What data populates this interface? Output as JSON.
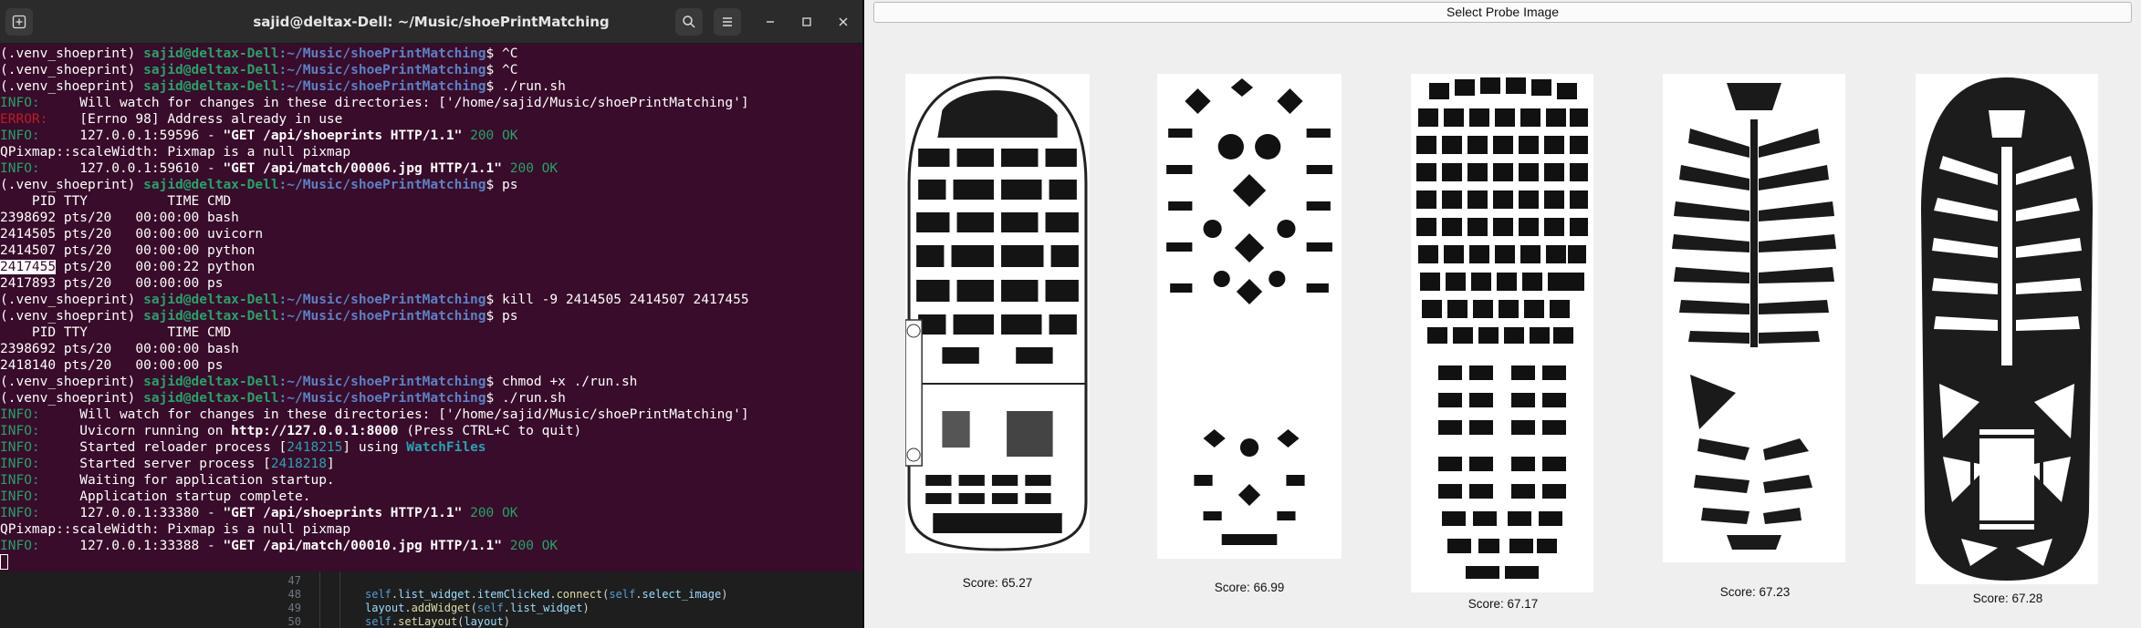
{
  "terminal": {
    "title": "sajid@deltax-Dell: ~/Music/shoePrintMatching",
    "new_tab_icon": "new-tab-icon",
    "search_icon": "search-icon",
    "menu_icon": "hamburger-menu-icon",
    "prompt": {
      "env": "(.venv_shoeprint) ",
      "user": "sajid@deltax-Dell",
      "path": ":~/Music/shoePrintMatching",
      "symbol": "$ "
    },
    "lines": [
      {
        "t": "cmd",
        "cmd": "^C"
      },
      {
        "t": "cmd",
        "cmd": "^C"
      },
      {
        "t": "cmd",
        "cmd": "./run.sh"
      },
      {
        "t": "info",
        "text": "     Will watch for changes in these directories: ['/home/sajid/Music/shoePrintMatching']"
      },
      {
        "t": "error",
        "text": "    [Errno 98] Address already in use"
      },
      {
        "t": "access",
        "ip": "     127.0.0.1:59596 - ",
        "req": "\"GET /api/shoeprints HTTP/1.1\"",
        "status": " 200 OK"
      },
      {
        "t": "plain",
        "text": "QPixmap::scaleWidth: Pixmap is a null pixmap"
      },
      {
        "t": "access",
        "ip": "     127.0.0.1:59610 - ",
        "req": "\"GET /api/match/00006.jpg HTTP/1.1\"",
        "status": " 200 OK"
      },
      {
        "t": "cmd",
        "cmd": "ps"
      },
      {
        "t": "plain",
        "text": "    PID TTY          TIME CMD"
      },
      {
        "t": "plain",
        "text": "2398692 pts/20   00:00:00 bash"
      },
      {
        "t": "plain",
        "text": "2414505 pts/20   00:00:00 uvicorn"
      },
      {
        "t": "plain",
        "text": "2414507 pts/20   00:00:00 python"
      },
      {
        "t": "selected",
        "sel": "2417455",
        "text": " pts/20   00:00:22 python"
      },
      {
        "t": "plain",
        "text": "2417893 pts/20   00:00:00 ps"
      },
      {
        "t": "cmd",
        "cmd": "kill -9 2414505 2414507 2417455"
      },
      {
        "t": "cmd",
        "cmd": "ps"
      },
      {
        "t": "plain",
        "text": "    PID TTY          TIME CMD"
      },
      {
        "t": "plain",
        "text": "2398692 pts/20   00:00:00 bash"
      },
      {
        "t": "plain",
        "text": "2418140 pts/20   00:00:00 ps"
      },
      {
        "t": "cmd",
        "cmd": "chmod +x ./run.sh"
      },
      {
        "t": "cmd",
        "cmd": "./run.sh"
      },
      {
        "t": "info",
        "text": "     Will watch for changes in these directories: ['/home/sajid/Music/shoePrintMatching']"
      },
      {
        "t": "info_parts",
        "parts": [
          [
            "",
            "     Uvicorn running on "
          ],
          [
            "b",
            "http://127.0.0.1:8000"
          ],
          [
            "",
            " (Press CTRL+C to quit)"
          ]
        ]
      },
      {
        "t": "info_parts",
        "parts": [
          [
            "",
            "     Started reloader process ["
          ],
          [
            "num",
            "2418215"
          ],
          [
            "",
            "] using "
          ],
          [
            "cyan",
            "WatchFiles"
          ]
        ]
      },
      {
        "t": "info_parts",
        "parts": [
          [
            "",
            "     Started server process ["
          ],
          [
            "num",
            "2418218"
          ],
          [
            "",
            "]"
          ]
        ]
      },
      {
        "t": "info",
        "text": "     Waiting for application startup."
      },
      {
        "t": "info",
        "text": "     Application startup complete."
      },
      {
        "t": "access",
        "ip": "     127.0.0.1:33380 - ",
        "req": "\"GET /api/shoeprints HTTP/1.1\"",
        "status": " 200 OK"
      },
      {
        "t": "plain",
        "text": "QPixmap::scaleWidth: Pixmap is a null pixmap"
      },
      {
        "t": "access",
        "ip": "     127.0.0.1:33388 - ",
        "req": "\"GET /api/match/00010.jpg HTTP/1.1\"",
        "status": " 200 OK"
      },
      {
        "t": "cursor"
      }
    ],
    "labels": {
      "info": "INFO:",
      "error": "ERROR:"
    }
  },
  "editor": {
    "line_numbers": [
      "47",
      "48",
      "49",
      "50"
    ],
    "lines": [
      [
        [
          "",
          ""
        ]
      ],
      [
        [
          "kw",
          "self"
        ],
        [
          "",
          "."
        ],
        [
          "var",
          "list_widget"
        ],
        [
          "",
          "."
        ],
        [
          "var",
          "itemClicked"
        ],
        [
          "",
          "."
        ],
        [
          "fn",
          "connect"
        ],
        [
          "",
          "("
        ],
        [
          "kw",
          "self"
        ],
        [
          "",
          "."
        ],
        [
          "var",
          "select_image"
        ],
        [
          "",
          ")"
        ]
      ],
      [
        [
          "var",
          "layout"
        ],
        [
          "",
          "."
        ],
        [
          "fn",
          "addWidget"
        ],
        [
          "",
          "("
        ],
        [
          "kw",
          "self"
        ],
        [
          "",
          "."
        ],
        [
          "var",
          "list_widget"
        ],
        [
          "",
          ")"
        ]
      ],
      [
        [
          "kw",
          "self"
        ],
        [
          "",
          "."
        ],
        [
          "fn",
          "setLayout"
        ],
        [
          "",
          "("
        ],
        [
          "var",
          "layout"
        ],
        [
          "",
          ")"
        ]
      ]
    ]
  },
  "app": {
    "select_button_label": "Select Probe Image",
    "results": [
      {
        "score": "Score: 65.27",
        "image": "shoeprint-result-1"
      },
      {
        "score": "Score: 66.99",
        "image": "shoeprint-result-2"
      },
      {
        "score": "Score: 67.17",
        "image": "shoeprint-result-3"
      },
      {
        "score": "Score: 67.23",
        "image": "shoeprint-result-4"
      },
      {
        "score": "Score: 67.28",
        "image": "shoeprint-result-5"
      }
    ]
  }
}
